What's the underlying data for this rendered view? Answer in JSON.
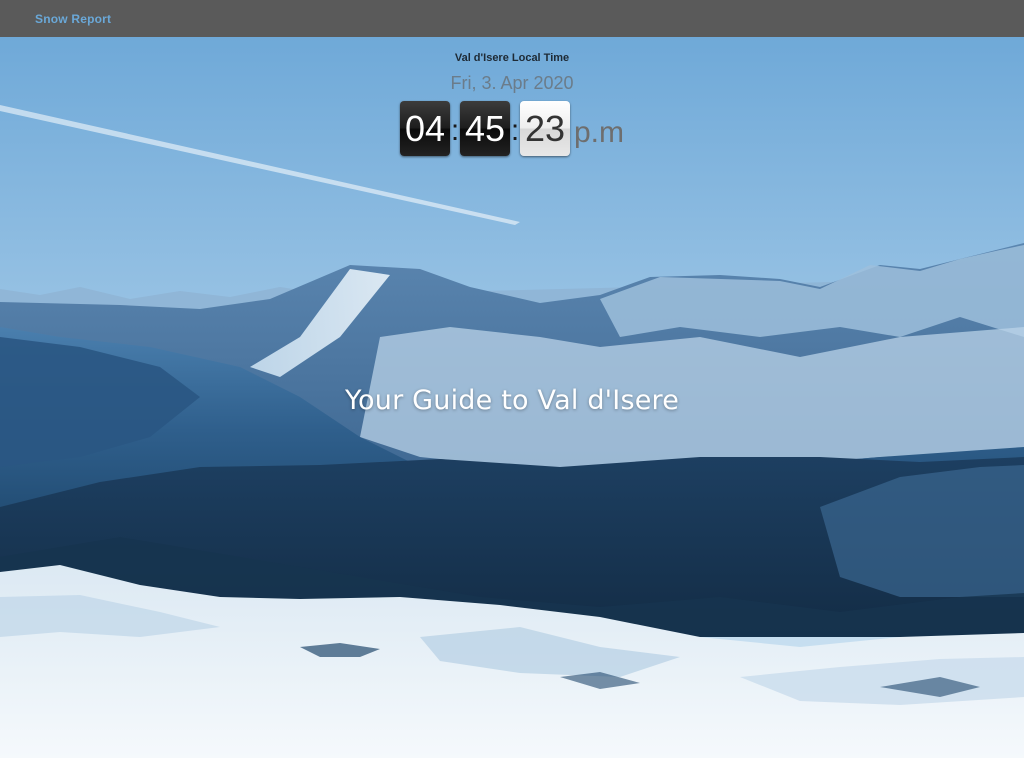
{
  "nav": {
    "snow_report_label": "Snow Report"
  },
  "clock": {
    "title": "Val d'Isere Local Time",
    "date": "Fri, 3. Apr 2020",
    "hours": "04",
    "minutes": "45",
    "seconds": "23",
    "separator": ":",
    "period": "p.m"
  },
  "hero": {
    "tagline": "Your Guide to Val d'Isere"
  },
  "colors": {
    "topbar": "#5a5a5a",
    "link": "#6aa8d8",
    "sky": "#7fb6e0"
  }
}
